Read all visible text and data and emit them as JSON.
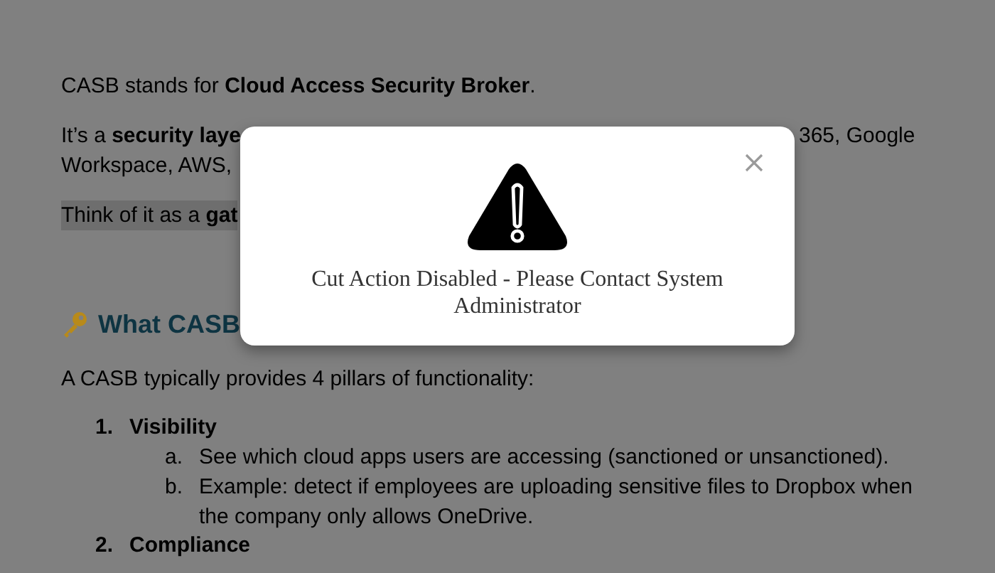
{
  "document": {
    "blocks": [
      {
        "kind": "para",
        "highlighted": false,
        "lines": [
          {
            "left": "CASB stands for **Cloud Access Security Broker**."
          }
        ]
      },
      {
        "kind": "para",
        "highlighted": false,
        "lines": [
          {
            "left": "It’s a **security laye**",
            "right": "365, Google"
          },
          {
            "left": "Workspace, AWS,"
          }
        ]
      },
      {
        "kind": "para",
        "highlighted": true,
        "lines": [
          {
            "left": "Think of it as a **gat**"
          }
        ]
      },
      {
        "kind": "heading",
        "text": "What CASB"
      },
      {
        "kind": "para",
        "highlighted": false,
        "lines": [
          {
            "left": "A CASB typically provides 4 pillars of functionality:"
          }
        ]
      },
      {
        "kind": "list",
        "items": [
          {
            "number": "1.",
            "text": "Visibility",
            "children": [
              {
                "number": "a.",
                "text": "See which cloud apps users are accessing (sanctioned or unsanctioned)."
              },
              {
                "number": "b.",
                "text": "Example: detect if employees are uploading sensitive files to Dropbox when the company only allows OneDrive."
              }
            ]
          },
          {
            "number": "2.",
            "text": "Compliance"
          }
        ]
      }
    ]
  },
  "dialog": {
    "message": "Cut Action Disabled - Please Contact System Administrator"
  }
}
